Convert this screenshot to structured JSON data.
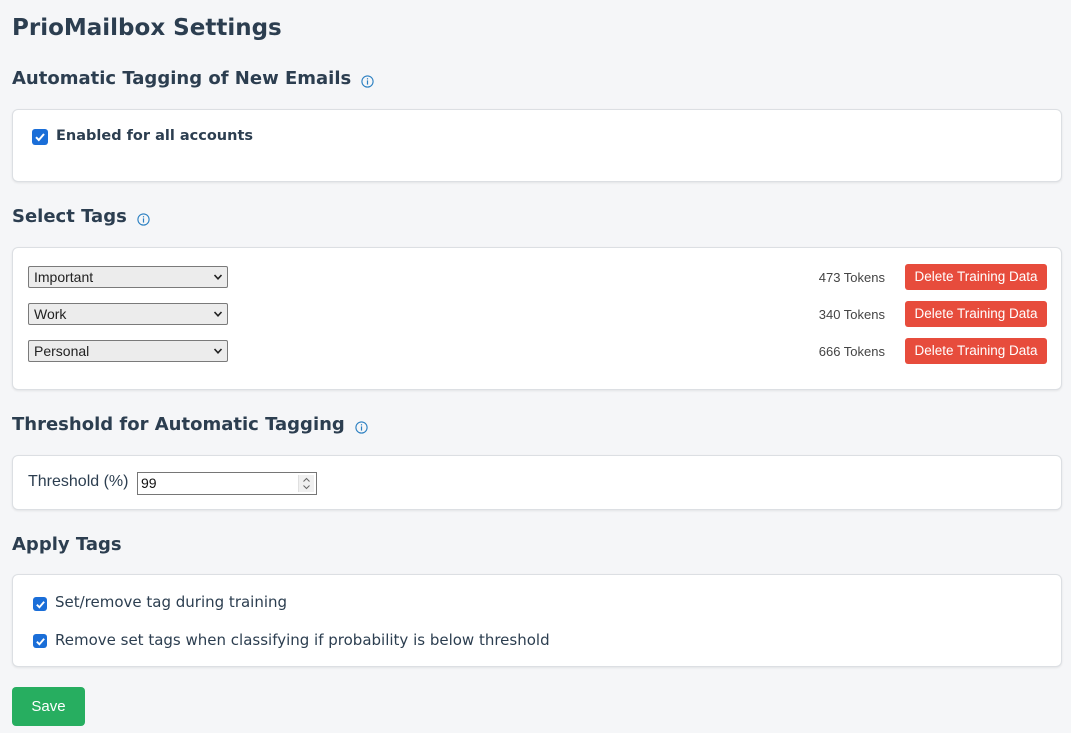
{
  "page": {
    "title": "PrioMailbox Settings"
  },
  "auto_tagging": {
    "heading": "Automatic Tagging of New Emails",
    "enabled_label": "Enabled for all accounts",
    "enabled": true
  },
  "select_tags": {
    "heading": "Select Tags",
    "rows": [
      {
        "tag": "Important",
        "tokens": "473 Tokens",
        "delete_label": "Delete Training Data"
      },
      {
        "tag": "Work",
        "tokens": "340 Tokens",
        "delete_label": "Delete Training Data"
      },
      {
        "tag": "Personal",
        "tokens": "666 Tokens",
        "delete_label": "Delete Training Data"
      }
    ]
  },
  "threshold": {
    "heading": "Threshold for Automatic Tagging",
    "label": "Threshold (%)",
    "value": "99"
  },
  "apply_tags": {
    "heading": "Apply Tags",
    "options": [
      {
        "label": "Set/remove tag during training",
        "checked": true
      },
      {
        "label": "Remove set tags when classifying if probability is below threshold",
        "checked": true
      }
    ]
  },
  "actions": {
    "save_label": "Save"
  },
  "colors": {
    "accent": "#1a6ed8",
    "danger": "#e74c3c",
    "success": "#27ae60",
    "heading": "#2c3e50",
    "info_icon": "#2a7fc1"
  }
}
